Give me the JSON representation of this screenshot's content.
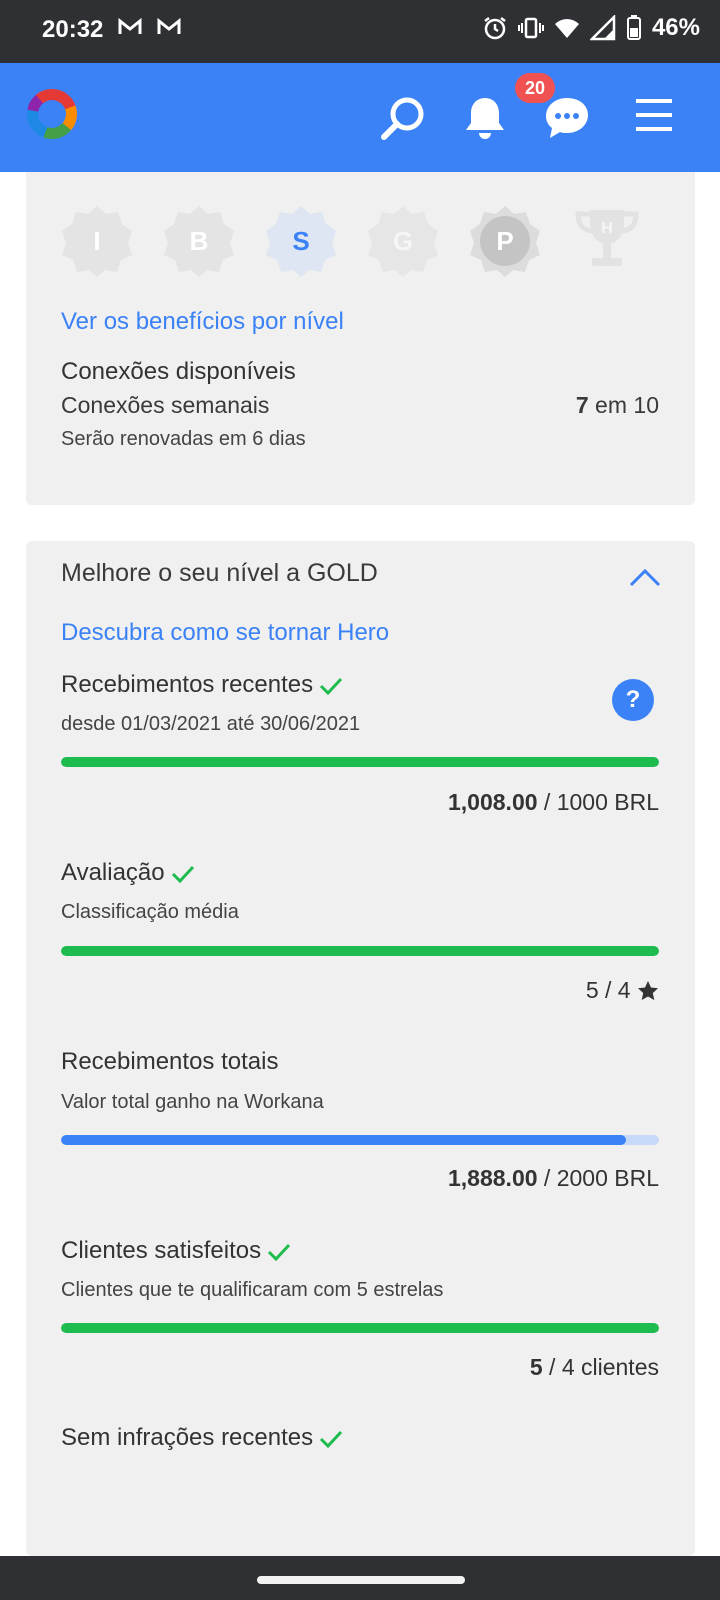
{
  "status_bar": {
    "time": "20:32",
    "battery": "46%",
    "icons": [
      "gmail-icon",
      "gmail-icon",
      "alarm-icon",
      "vibrate-icon",
      "wifi-icon",
      "signal-icon",
      "battery-icon"
    ]
  },
  "app_bar": {
    "notifications_count": "20",
    "icons": [
      "logo",
      "search-icon",
      "bell-icon",
      "chat-icon",
      "menu-icon"
    ],
    "color": "#3b82f6"
  },
  "levels": {
    "items": [
      {
        "letter": "I",
        "state": "inactive"
      },
      {
        "letter": "B",
        "state": "inactive"
      },
      {
        "letter": "S",
        "state": "current"
      },
      {
        "letter": "G",
        "state": "inactive"
      },
      {
        "letter": "P",
        "state": "inactive-dark"
      },
      {
        "letter": "H",
        "state": "trophy"
      }
    ],
    "benefits_link": "Ver os benefícios por nível"
  },
  "connections": {
    "heading": "Conexões disponíveis",
    "weekly_label": "Conexões semanais",
    "weekly_used": "7",
    "weekly_total": " em 10",
    "renew_note": "Serão renovadas em 6 dias"
  },
  "upgrade": {
    "title": "Melhore o seu nível a GOLD",
    "hero_link": "Descubra como se tornar Hero",
    "help_label": "?",
    "criteria": [
      {
        "title": "Recebimentos recentes",
        "subtitle": "desde 01/03/2021 até 30/06/2021",
        "value": "1,008.00",
        "target": " / 1000 BRL",
        "progress": 1.0,
        "met": true
      },
      {
        "title": "Avaliação",
        "subtitle": "Classificação média",
        "value": "5",
        "target": " / 4",
        "progress": 1.0,
        "met": true
      },
      {
        "title": "Recebimentos totais",
        "subtitle": "Valor total ganho na Workana",
        "value": "1,888.00",
        "target": " / 2000 BRL",
        "progress": 0.944,
        "met": false
      },
      {
        "title": "Clientes satisfeitos",
        "subtitle": "Clientes que te qualificaram com 5 estrelas",
        "value": "5",
        "target": " / 4 clientes",
        "progress": 1.0,
        "met": true
      },
      {
        "title": "Sem infrações recentes",
        "met": true
      }
    ]
  },
  "colors": {
    "accent": "#3b82f6",
    "success": "#1ebc4f",
    "badge": "#f05252",
    "card_bg": "#f0f0f0"
  }
}
